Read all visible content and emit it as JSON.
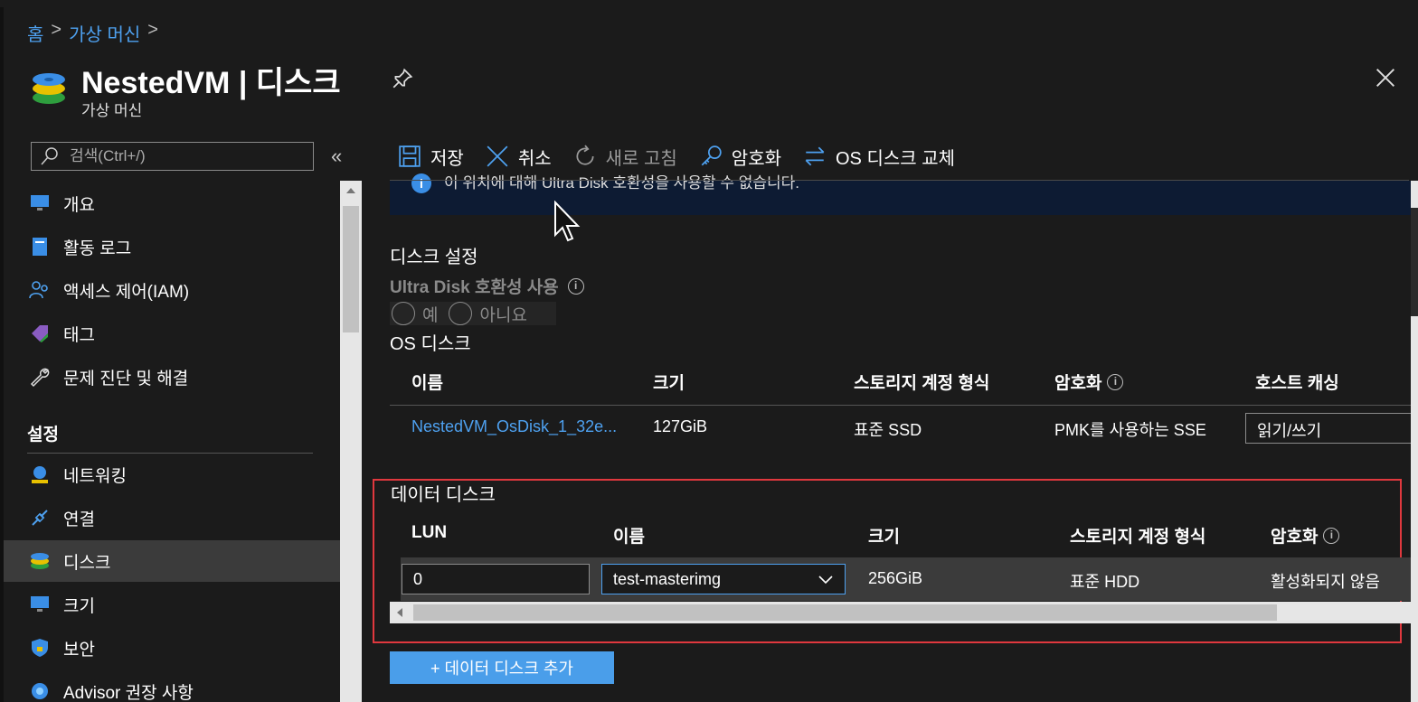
{
  "breadcrumb": {
    "home": "홈",
    "vms": "가상 머신",
    "sep": ">"
  },
  "header": {
    "title": "NestedVM | 디스크",
    "subtitle": "가상 머신"
  },
  "search": {
    "placeholder": "검색(Ctrl+/)"
  },
  "sidebar": {
    "collapse": "«",
    "items": [
      {
        "label": "개요",
        "icon": "monitor-icon"
      },
      {
        "label": "활동 로그",
        "icon": "log-icon"
      },
      {
        "label": "액세스 제어(IAM)",
        "icon": "people-icon"
      },
      {
        "label": "태그",
        "icon": "tag-icon"
      },
      {
        "label": "문제 진단 및 해결",
        "icon": "wrench-icon"
      }
    ],
    "section": "설정",
    "settings_items": [
      {
        "label": "네트워킹",
        "icon": "network-icon"
      },
      {
        "label": "연결",
        "icon": "connect-icon"
      },
      {
        "label": "디스크",
        "icon": "disk-icon",
        "active": true
      },
      {
        "label": "크기",
        "icon": "monitor-icon"
      },
      {
        "label": "보안",
        "icon": "shield-icon"
      },
      {
        "label": "Advisor 권장 사항",
        "icon": "advisor-icon"
      }
    ]
  },
  "toolbar": {
    "save": "저장",
    "cancel": "취소",
    "refresh": "새로 고침",
    "encrypt": "암호화",
    "swap_os": "OS 디스크 교체"
  },
  "banner": {
    "text": "이 위치에 대해 Ultra Disk 호환성을 사용할 수 없습니다."
  },
  "disk_settings": {
    "heading": "디스크 설정",
    "ultra_label": "Ultra Disk 호환성 사용",
    "yes": "예",
    "no": "아니요"
  },
  "os_disk": {
    "heading": "OS 디스크",
    "columns": [
      "이름",
      "크기",
      "스토리지 계정 형식",
      "암호화",
      "호스트 캐싱"
    ],
    "row": {
      "name": "NestedVM_OsDisk_1_32e...",
      "size": "127GiB",
      "storage": "표준 SSD",
      "encryption": "PMK를 사용하는 SSE",
      "caching": "읽기/쓰기"
    }
  },
  "data_disks": {
    "heading": "데이터 디스크",
    "columns": [
      "LUN",
      "이름",
      "크기",
      "스토리지 계정 형식",
      "암호화"
    ],
    "row": {
      "lun": "0",
      "name": "test-masterimg",
      "size": "256GiB",
      "storage": "표준 HDD",
      "encryption": "활성화되지 않음"
    },
    "add_button": "+ 데이터 디스크 추가"
  },
  "colors": {
    "accent": "#4ea1f0",
    "highlight": "#e0383e",
    "button": "#4a9eea"
  }
}
